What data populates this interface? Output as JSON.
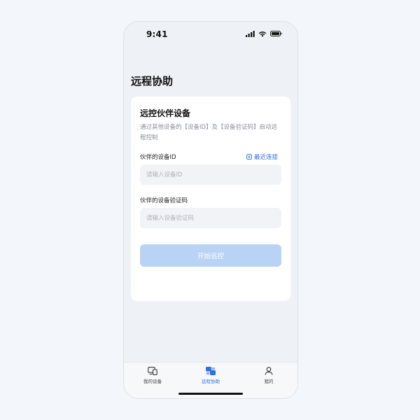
{
  "status_bar": {
    "time": "9:41",
    "icons": [
      "signal-icon",
      "wifi-icon",
      "battery-icon"
    ]
  },
  "page": {
    "title": "远程协助"
  },
  "card": {
    "title": "远控伙伴设备",
    "description": "通过其他设备的【设备ID】及【设备验证码】启动远程控制",
    "device_id_label": "伙伴的设备ID",
    "recent_label": "最近连接",
    "device_id_placeholder": "请输入设备ID",
    "device_id_value": "",
    "code_label": "伙伴的设备验证码",
    "code_placeholder": "请输入设备验证码",
    "code_value": "",
    "start_label": "开始远控"
  },
  "tabs": [
    {
      "label": "我的设备",
      "icon": "devices-icon",
      "active": false
    },
    {
      "label": "远程协助",
      "icon": "remote-assist-icon",
      "active": true
    },
    {
      "label": "我的",
      "icon": "profile-icon",
      "active": false
    }
  ],
  "colors": {
    "accent": "#2f6fe0",
    "button_disabled": "#b9d3f5",
    "background": "#eef2f6",
    "card": "#ffffff",
    "input_bg": "#f1f3f6"
  }
}
